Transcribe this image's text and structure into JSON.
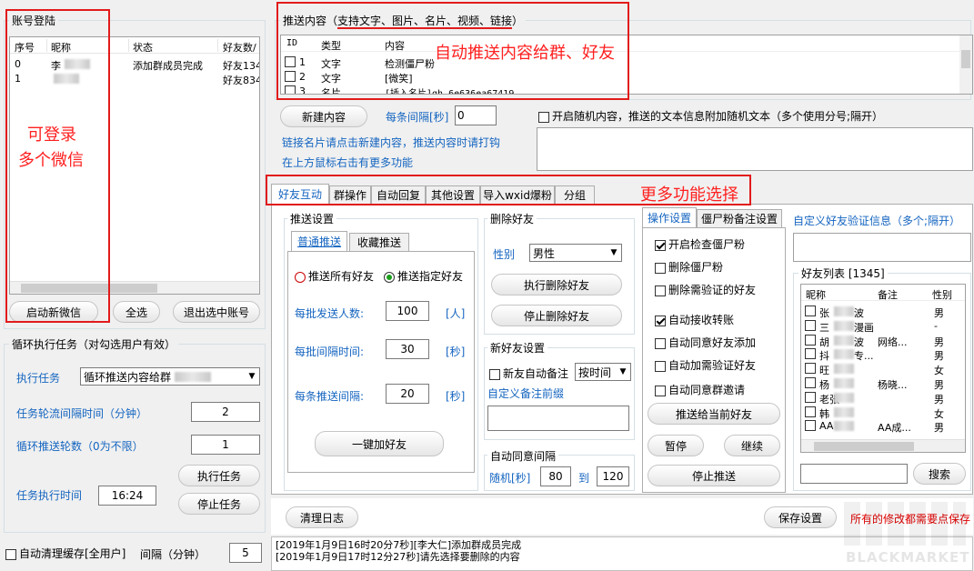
{
  "login": {
    "title": "账号登陆",
    "columns": [
      "序号",
      "昵称",
      "状态",
      "好友数/"
    ],
    "rows": [
      {
        "id": "0",
        "nick": "李",
        "status": "添加群成员完成",
        "friends": "好友134"
      },
      {
        "id": "1",
        "nick": "",
        "status": "",
        "friends": "好友834"
      }
    ],
    "btn_start": "启动新微信",
    "btn_select_all": "全选",
    "btn_logout": "退出选中账号"
  },
  "loop": {
    "title": "循环执行任务（对勾选用户有效）",
    "exec_label": "执行任务",
    "exec_value": "循环推送内容给群",
    "interval_label": "任务轮流间隔时间（分钟）",
    "interval_value": "2",
    "rounds_label": "循环推送轮数（0为不限）",
    "rounds_value": "1",
    "time_label": "任务执行时间",
    "time_value": "16:24",
    "btn_exec": "执行任务",
    "btn_stop": "停止任务"
  },
  "cache": {
    "label": "自动清理缓存[全用户]",
    "interval_label": "间隔（分钟）",
    "interval_value": "5"
  },
  "push": {
    "title": "推送内容（",
    "title_hl": "支持文字、图片、名片、视频、链接",
    "title_end": "）",
    "columns": [
      "ID",
      "类型",
      "内容"
    ],
    "rows": [
      {
        "id": "1",
        "type": "文字",
        "content": "检测僵尸粉"
      },
      {
        "id": "2",
        "type": "文字",
        "content": "[微笑]"
      },
      {
        "id": "3",
        "type": "名片",
        "content": "[插入名片]gh_6e636ea67419"
      }
    ],
    "btn_new": "新建内容",
    "interval_label": "每条间隔[秒]",
    "interval_value": "0",
    "random_label": "开启随机内容，推送的文本信息附加随机文本（多个使用分号;隔开）",
    "tip1": "链接名片请点击新建内容，推送内容时请打钩",
    "tip2": "在上方鼠标右击有更多功能"
  },
  "tabs": [
    "好友互动",
    "群操作",
    "自动回复",
    "其他设置",
    "导入wxid爆粉",
    "分组"
  ],
  "push_settings": {
    "title": "推送设置",
    "subtabs": [
      "普通推送",
      "收藏推送"
    ],
    "radio_all": "推送所有好友",
    "radio_specified": "推送指定好友",
    "batch_label": "每批发送人数:",
    "batch_value": "100",
    "batch_unit": "[人]",
    "batch_interval_label": "每批间隔时间:",
    "batch_interval_value": "30",
    "batch_interval_unit": "[秒]",
    "item_interval_label": "每条推送间隔:",
    "item_interval_value": "20",
    "item_interval_unit": "[秒]",
    "btn_add": "一键加好友"
  },
  "delete_friend": {
    "title": "删除好友",
    "gender_label": "性别",
    "gender_value": "男性",
    "btn_exec": "执行删除好友",
    "btn_stop": "停止删除好友"
  },
  "new_friend": {
    "title": "新好友设置",
    "auto_note": "新友自动备注",
    "note_mode": "按时间",
    "custom_prefix": "自定义备注前缀"
  },
  "auto_agree": {
    "title": "自动同意间隔",
    "random_label": "随机[秒]",
    "from": "80",
    "to_label": "到",
    "to": "120"
  },
  "ops": {
    "tabs": [
      "操作设置",
      "僵尸粉备注设置"
    ],
    "items": [
      {
        "label": "开启检查僵尸粉",
        "checked": true
      },
      {
        "label": "删除僵尸粉",
        "checked": false
      },
      {
        "label": "删除需验证的好友",
        "checked": false
      },
      {
        "label": "自动接收转账",
        "checked": true
      },
      {
        "label": "自动同意好友添加",
        "checked": false
      },
      {
        "label": "自动加需验证好友",
        "checked": false
      },
      {
        "label": "自动同意群邀请",
        "checked": false
      }
    ],
    "btn_push_current": "推送给当前好友",
    "btn_pause": "暂停",
    "btn_continue": "继续",
    "btn_stop_push": "停止推送"
  },
  "verify": {
    "label": "自定义好友验证信息（多个;隔开）"
  },
  "friends": {
    "title": "好友列表 [1345]",
    "columns": [
      "昵称",
      "备注",
      "性别"
    ],
    "rows": [
      {
        "nick": "张",
        "nick2": "波",
        "note": "",
        "gender": "男"
      },
      {
        "nick": "三",
        "nick2": "漫画",
        "note": "",
        "gender": "-"
      },
      {
        "nick": "胡",
        "nick2": "波",
        "note": "网络...",
        "gender": "男"
      },
      {
        "nick": "抖",
        "nick2": "专...",
        "note": "",
        "gender": "男"
      },
      {
        "nick": "旺",
        "nick2": "",
        "note": "",
        "gender": "女"
      },
      {
        "nick": "杨",
        "nick2": "",
        "note": "杨晓...",
        "gender": "男"
      },
      {
        "nick": "老张",
        "nick2": "",
        "note": "",
        "gender": "男"
      },
      {
        "nick": "韩",
        "nick2": "",
        "note": "",
        "gender": "女"
      },
      {
        "nick": "AA",
        "nick2": "",
        "note": "AA成...",
        "gender": "男"
      }
    ],
    "btn_search": "搜索"
  },
  "log": {
    "btn_clear": "清理日志",
    "btn_save": "保存设置",
    "save_warn": "所有的修改都需要点保存",
    "lines": [
      "[2019年1月9日16时20分7秒][李大仁]添加群成员完成",
      "[2019年1月9日17时12分27秒]请先选择要删除的内容"
    ]
  },
  "annotations": {
    "login": "可登录",
    "login2": "多个微信",
    "push": "自动推送内容给群、好友",
    "more": "更多功能选择"
  },
  "watermark": "BLACKMARKET",
  "colors": {
    "annotation": "#e21b1b",
    "blue_text": "#1565c0",
    "red_warn": "#e00000"
  }
}
